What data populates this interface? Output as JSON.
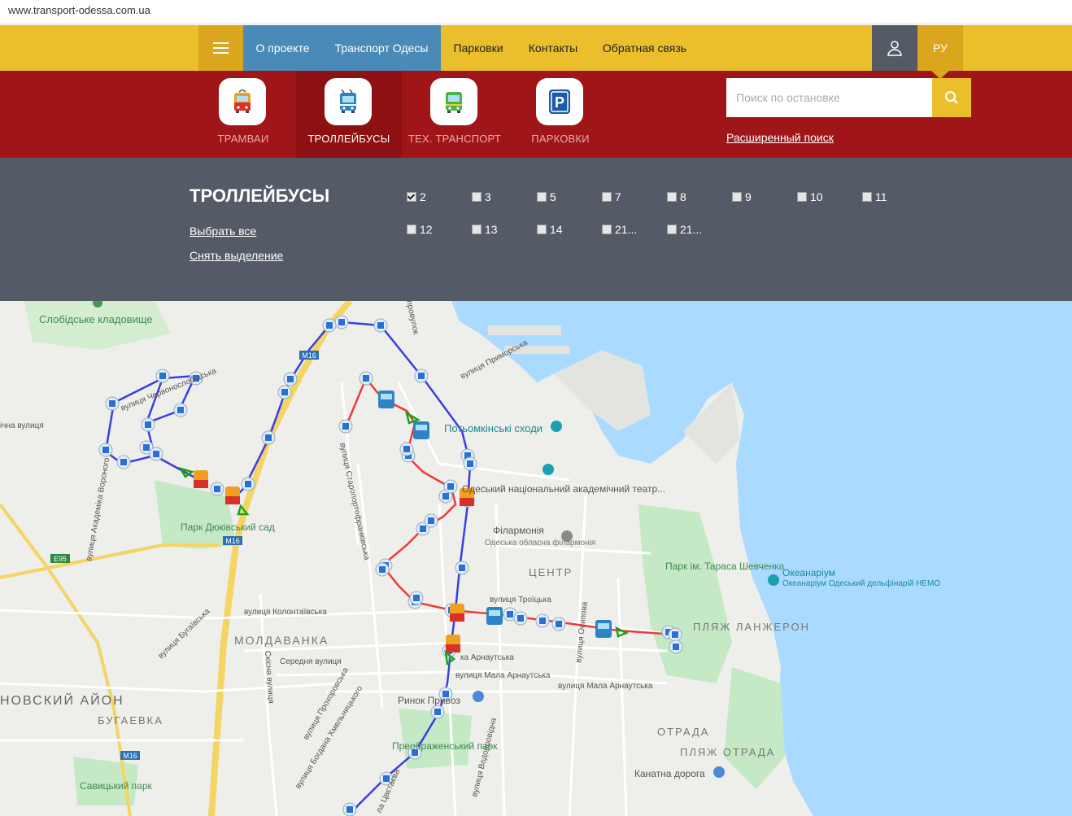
{
  "browser": {
    "url": "www.transport-odessa.com.ua"
  },
  "topnav": {
    "items": [
      "О проекте",
      "Транспорт Одесы",
      "Парковки",
      "Контакты",
      "Обратная связь"
    ],
    "lang": "РУ"
  },
  "tabs": [
    {
      "label": "ТРАМВАИ",
      "icon": "tram-icon"
    },
    {
      "label": "ТРОЛЛЕЙБУСЫ",
      "icon": "trolleybus-icon"
    },
    {
      "label": "ТЕХ. ТРАНСПОРТ",
      "icon": "service-vehicle-icon"
    },
    {
      "label": "ПАРКОВКИ",
      "icon": "parking-icon"
    }
  ],
  "search": {
    "placeholder": "Поиск по остановке",
    "advanced": "Расширенный поиск"
  },
  "filter": {
    "title": "ТРОЛЛЕЙБУСЫ",
    "select_all": "Выбрать все",
    "clear": "Снять выделение",
    "routes": [
      {
        "label": "2",
        "checked": true
      },
      {
        "label": "3",
        "checked": false
      },
      {
        "label": "5",
        "checked": false
      },
      {
        "label": "7",
        "checked": false
      },
      {
        "label": "8",
        "checked": false
      },
      {
        "label": "9",
        "checked": false
      },
      {
        "label": "10",
        "checked": false
      },
      {
        "label": "11",
        "checked": false
      },
      {
        "label": "12",
        "checked": false
      },
      {
        "label": "13",
        "checked": false
      },
      {
        "label": "14",
        "checked": false
      },
      {
        "label": "21...",
        "checked": false
      },
      {
        "label": "21...",
        "checked": false
      }
    ]
  },
  "map": {
    "labels": {
      "cemetery": "Слобідське кладовище",
      "street_chervonosl": "вулиця Червонослобідська",
      "street_left": "ічна вулиця",
      "street_akad": "вулиця Академіка Вороного",
      "park_dyuk": "Парк Дюківський сад",
      "street_staroport": "вулиця Старопортофранківська",
      "street_prov": "провулок",
      "street_prymorska": "вулиця Приморська",
      "potemkin": "Потьомкінські сходи",
      "theatre": "Одеський національний академічний театр...",
      "philharmonic": "Філармонія",
      "philharmonic_sub": "Одеська обласна філармонія",
      "center": "ЦЕНТР",
      "park_shevchenko": "Парк ім. Тараса Шевченка",
      "oceanarium": "Океанаріум",
      "oceanarium_sub": "Океанаріум Одеський дельфінарій НЕМО",
      "beach_lanzheron": "ПЛЯЖ ЛАНЖЕРОН",
      "street_kolontaivska": "вулиця Колонтаївська",
      "moldavanka": "МОЛДАВАНКА",
      "street_troitska": "вулиця Троїцька",
      "street_osypova": "вулиця Осипова",
      "street_bugaivska": "вулиця Бугаївська",
      "street_seredna": "Середня вулиця",
      "street_skisna": "Скісна вулиця",
      "street_v_arn": "ка Арнаутська",
      "street_m_arn": "вулиця Мала Арнаутська",
      "street_m_arn2": "вулиця Мала Арнаутська",
      "market": "Ринок Привоз",
      "district_left": "НОВСКИЙ АЙОН",
      "bugaevka": "БУГАЕВКА",
      "street_prokh": "вулиця Прохоровська",
      "street_bogdana": "вулиця Богдана Хмельницького",
      "park_preobr": "Преображенський парк",
      "street_vodopr": "вулиця Водопровідна",
      "otrada": "ОТРАДА",
      "beach_otrada": "ПЛЯЖ ОТРАДА",
      "kanatna": "Канатна дорога",
      "savytskyi": "Савицький парк",
      "street_tsvetaeva": "ла Цвєтаєва",
      "road_m16a": "M16",
      "road_m16b": "M16",
      "road_m16c": "M16",
      "road_e95": "E95"
    },
    "colors": {
      "land": "#eeeeea",
      "water": "#aadaff",
      "park": "#c5e8c5",
      "route_blue": "#3a3fe0",
      "route_red": "#ee3a3a",
      "road_yellow": "#f4d462"
    }
  }
}
